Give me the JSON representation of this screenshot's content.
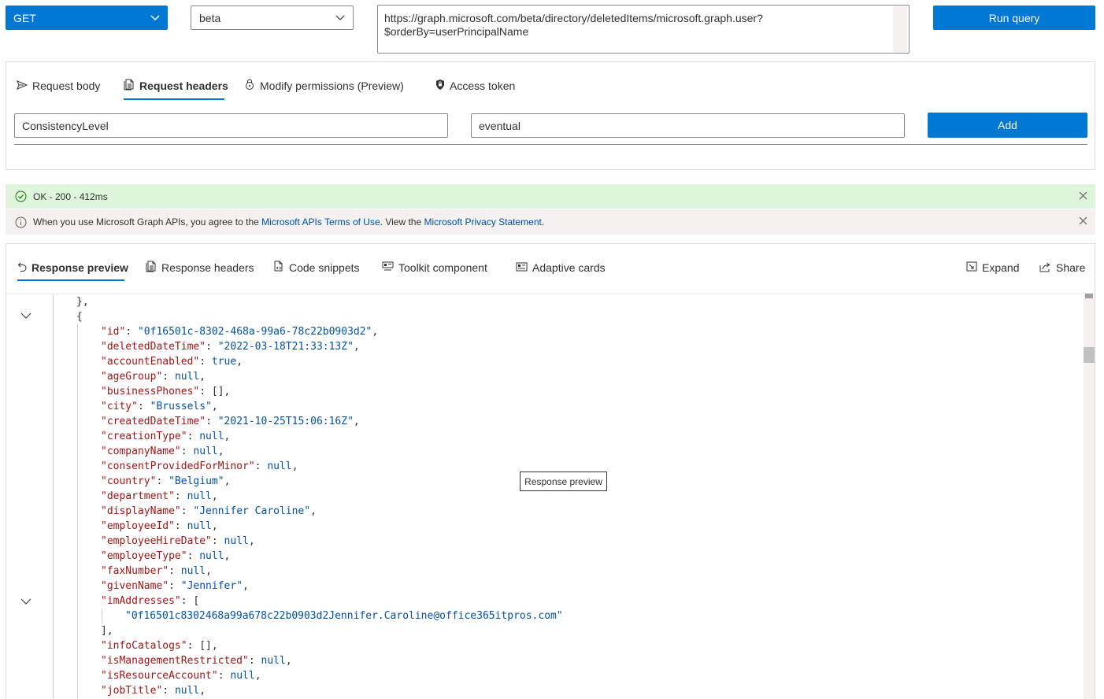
{
  "toolbar": {
    "method": "GET",
    "version": "beta",
    "url_line1": "https://graph.microsoft.com/beta/directory/deletedItems/microsoft.graph.user?",
    "url_line2": "$orderBy=userPrincipalName",
    "run_label": "Run query"
  },
  "request": {
    "tabs": [
      "Request body",
      "Request headers",
      "Modify permissions (Preview)",
      "Access token"
    ],
    "active_tab": "Request headers",
    "header_key": "ConsistencyLevel",
    "header_value": "eventual",
    "add_label": "Add"
  },
  "status": {
    "ok_text": "OK - 200 - 412ms",
    "info_prefix": "When you use Microsoft Graph APIs, you agree to the ",
    "info_link1": "Microsoft APIs Terms of Use",
    "info_mid": ". View the ",
    "info_link2": "Microsoft Privacy Statement",
    "info_suffix": "."
  },
  "response": {
    "tabs": [
      "Response preview",
      "Response headers",
      "Code snippets",
      "Toolkit component",
      "Adaptive cards"
    ],
    "active_tab": "Response preview",
    "expand_label": "Expand",
    "share_label": "Share",
    "tooltip": "Response preview"
  },
  "json_lines": [
    {
      "indent": 0,
      "text": "},"
    },
    {
      "indent": 0,
      "text": "{"
    },
    {
      "indent": 1,
      "key": "id",
      "value": "\"0f16501c-8302-468a-99a6-78c22b0903d2\"",
      "comma": true
    },
    {
      "indent": 1,
      "key": "deletedDateTime",
      "value": "\"2022-03-18T21:33:13Z\"",
      "comma": true
    },
    {
      "indent": 1,
      "key": "accountEnabled",
      "value": "true",
      "comma": true
    },
    {
      "indent": 1,
      "key": "ageGroup",
      "value": "null",
      "comma": true
    },
    {
      "indent": 1,
      "key": "businessPhones",
      "value": "[]",
      "comma": true
    },
    {
      "indent": 1,
      "key": "city",
      "value": "\"Brussels\"",
      "comma": true
    },
    {
      "indent": 1,
      "key": "createdDateTime",
      "value": "\"2021-10-25T15:06:16Z\"",
      "comma": true
    },
    {
      "indent": 1,
      "key": "creationType",
      "value": "null",
      "comma": true
    },
    {
      "indent": 1,
      "key": "companyName",
      "value": "null",
      "comma": true
    },
    {
      "indent": 1,
      "key": "consentProvidedForMinor",
      "value": "null",
      "comma": true
    },
    {
      "indent": 1,
      "key": "country",
      "value": "\"Belgium\"",
      "comma": true
    },
    {
      "indent": 1,
      "key": "department",
      "value": "null",
      "comma": true
    },
    {
      "indent": 1,
      "key": "displayName",
      "value": "\"Jennifer Caroline\"",
      "comma": true
    },
    {
      "indent": 1,
      "key": "employeeId",
      "value": "null",
      "comma": true
    },
    {
      "indent": 1,
      "key": "employeeHireDate",
      "value": "null",
      "comma": true
    },
    {
      "indent": 1,
      "key": "employeeType",
      "value": "null",
      "comma": true
    },
    {
      "indent": 1,
      "key": "faxNumber",
      "value": "null",
      "comma": true
    },
    {
      "indent": 1,
      "key": "givenName",
      "value": "\"Jennifer\"",
      "comma": true
    },
    {
      "indent": 1,
      "key": "imAddresses",
      "value": "[",
      "comma": false
    },
    {
      "indent": 2,
      "text": "\"0f16501c8302468a99a678c22b0903d2Jennifer.Caroline@office365itpros.com\"",
      "string": true
    },
    {
      "indent": 1,
      "text": "],"
    },
    {
      "indent": 1,
      "key": "infoCatalogs",
      "value": "[]",
      "comma": true
    },
    {
      "indent": 1,
      "key": "isManagementRestricted",
      "value": "null",
      "comma": true
    },
    {
      "indent": 1,
      "key": "isResourceAccount",
      "value": "null",
      "comma": true
    },
    {
      "indent": 1,
      "key": "jobTitle",
      "value": "null",
      "comma": true
    }
  ]
}
